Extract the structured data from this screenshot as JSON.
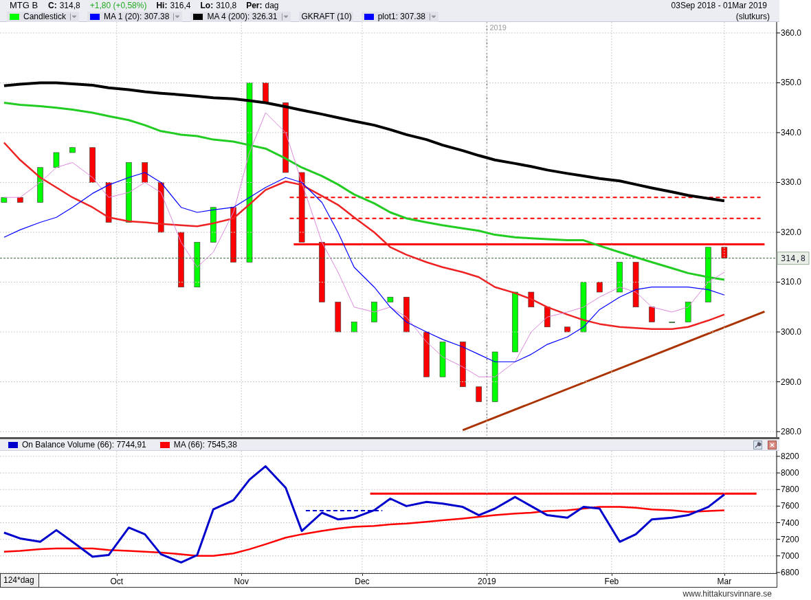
{
  "header": {
    "symbol": "MTG B",
    "fields": [
      {
        "label": "C:",
        "value": "314,8"
      },
      {
        "label": "Hi:",
        "value": "316,4"
      },
      {
        "label": "Lo:",
        "value": "310,8"
      },
      {
        "label": "Per:",
        "value": "dag"
      }
    ],
    "change": "+1,80 (+0,58%)",
    "date_range": "03Sep 2018 - 01Mar 2019",
    "price_type": "(slutkurs)"
  },
  "legend": [
    {
      "label": "Candlestick",
      "color": "#00ff00",
      "dropdown": true
    },
    {
      "label": "MA 1 (20): 307.38",
      "color": "#0000ff",
      "dropdown": true
    },
    {
      "label": "MA 4 (200): 326.31",
      "color": "#000000",
      "dropdown": true
    },
    {
      "label": "GKRAFT (10)",
      "dropdown": false
    },
    {
      "label": "plot1: 307.38",
      "color": "#0000ff",
      "dropdown": true
    }
  ],
  "price_chart": {
    "chart_data": {
      "type": "line",
      "grid": true,
      "ylim": [
        278.9,
        362.2
      ],
      "yticks": [
        {
          "value": 280,
          "label": "280.0"
        },
        {
          "value": 290,
          "label": "290.0"
        },
        {
          "value": 300,
          "label": "300.0"
        },
        {
          "value": 310,
          "label": "310.0"
        },
        {
          "value": 320,
          "label": "320.0"
        },
        {
          "value": 330,
          "label": "330.0"
        },
        {
          "value": 340,
          "label": "340.0"
        },
        {
          "value": 350,
          "label": "350.0"
        },
        {
          "value": 360,
          "label": "360.0"
        }
      ],
      "series": [
        {
          "color": "#000000",
          "values": [
            349.4,
            349.7,
            350,
            350,
            349.8,
            349.5,
            349,
            348.6,
            348.2,
            347.9,
            347.6,
            347.3,
            347,
            346.8,
            346.4,
            346,
            345.2,
            344.5,
            343.7,
            343,
            342.3,
            341.5,
            340.6,
            339.6,
            338.6,
            337.5,
            336.4,
            335.4,
            334.5,
            333.8,
            333.2,
            332.5,
            331.8,
            331.3,
            330.8,
            330.3,
            329.6,
            328.9,
            328.1,
            327.4,
            326.8,
            326.3
          ]
        },
        {
          "color": "#22cc22",
          "values": [
            346,
            345.6,
            345.3,
            345,
            344.6,
            344,
            343.3,
            342.5,
            341.5,
            340.3,
            339.6,
            339.3,
            338.6,
            338.2,
            337.5,
            336.8,
            334.8,
            333,
            331.3,
            329.6,
            327.6,
            325.8,
            324,
            322.8,
            322,
            321.4,
            320.8,
            320.3,
            319.5,
            319,
            318.8,
            318.6,
            318.4,
            318.4,
            317.3,
            316,
            315,
            314,
            312.8,
            311.8,
            311,
            310.5
          ]
        },
        {
          "color": "#ee2222",
          "values": [
            338,
            334.5,
            331,
            329,
            327,
            325,
            323,
            322.2,
            322,
            321.7,
            321.4,
            321.2,
            321.8,
            322.8,
            325.6,
            328.5,
            330.2,
            329.5,
            327.3,
            325.5,
            323,
            320,
            317,
            315.5,
            314,
            313,
            312,
            311,
            309,
            307.8,
            306.6,
            305,
            303.5,
            302.4,
            301.6,
            301,
            300.8,
            300.6,
            300.6,
            301,
            302.3,
            303.5
          ]
        },
        {
          "color": "#dd88dd",
          "values": [
            327,
            327,
            330,
            333,
            334,
            331,
            327,
            328,
            330,
            328,
            318,
            313,
            316,
            324,
            336,
            344,
            340,
            330,
            318,
            312,
            305,
            304,
            305,
            303,
            298,
            295,
            293,
            291,
            291,
            294,
            300,
            303,
            304,
            305,
            307,
            309,
            308,
            305,
            304,
            305,
            310,
            312
          ]
        },
        {
          "color": "#0000ff",
          "values": [
            319,
            320.5,
            322,
            323,
            325,
            327.8,
            329.5,
            331,
            332,
            330,
            325,
            324,
            324.5,
            325,
            327,
            329,
            331,
            330,
            326,
            320,
            313,
            309,
            305,
            302,
            300,
            298.5,
            297,
            295.5,
            294,
            294,
            295.5,
            297.5,
            299,
            301,
            304.5,
            307,
            308.5,
            309,
            309,
            309,
            308.5,
            307.4
          ]
        }
      ],
      "annotations": [
        "2019",
        "314,8"
      ]
    }
  },
  "obv_panel": {
    "legend": [
      {
        "label": "On Balance Volume (66): 7744,91",
        "color": "#0000cc"
      },
      {
        "label": "MA (66): 7545,38",
        "color": "#ff0000"
      }
    ],
    "chart_data": {
      "type": "line",
      "grid": true,
      "x": [
        "2018-09-03",
        "2018-09-07",
        "2018-09-12",
        "2018-09-16",
        "2018-09-20",
        "2018-09-25",
        "2018-09-29",
        "2018-10-04",
        "2018-10-08",
        "2018-10-12",
        "2018-10-17",
        "2018-10-21",
        "2018-10-25",
        "2018-10-30",
        "2018-11-03",
        "2018-11-07",
        "2018-11-12",
        "2018-11-16",
        "2018-11-21",
        "2018-11-25",
        "2018-11-29",
        "2018-12-04",
        "2018-12-08",
        "2018-12-12",
        "2018-12-17",
        "2018-12-21",
        "2018-12-26",
        "2018-12-30",
        "2019-01-03",
        "2019-01-08",
        "2019-01-12",
        "2019-01-16",
        "2019-01-21",
        "2019-01-25",
        "2019-01-29",
        "2019-02-03",
        "2019-02-07",
        "2019-02-11",
        "2019-02-16",
        "2019-02-20",
        "2019-02-25",
        "2019-03-01"
      ],
      "xlim": [
        "2018-09-02",
        "2019-03-14"
      ],
      "ylim": [
        6791,
        8266
      ],
      "xticks": [
        {
          "value": "2018-10-01",
          "label": "Oct"
        },
        {
          "value": "2018-11-01",
          "label": "Nov"
        },
        {
          "value": "2018-12-01",
          "label": "Dec"
        },
        {
          "value": "2019-01-01",
          "label": "2019"
        },
        {
          "value": "2019-02-01",
          "label": "Feb"
        },
        {
          "value": "2019-03-01",
          "label": "Mar"
        }
      ],
      "yticks": [
        {
          "value": 6800,
          "label": "6800"
        },
        {
          "value": 7000,
          "label": "7000"
        },
        {
          "value": 7200,
          "label": "7200"
        },
        {
          "value": 7400,
          "label": "7400"
        },
        {
          "value": 7600,
          "label": "7600"
        },
        {
          "value": 7800,
          "label": "7800"
        },
        {
          "value": 8000,
          "label": "8000"
        },
        {
          "value": 8200,
          "label": "8200"
        }
      ],
      "series": [
        {
          "color": "#ff0000",
          "values": [
            7050,
            7060,
            7080,
            7090,
            7090,
            7090,
            7070,
            7060,
            7050,
            7040,
            7020,
            7000,
            7000,
            7030,
            7080,
            7140,
            7220,
            7260,
            7300,
            7330,
            7350,
            7360,
            7380,
            7390,
            7410,
            7430,
            7450,
            7470,
            7490,
            7510,
            7520,
            7540,
            7550,
            7570,
            7590,
            7590,
            7580,
            7560,
            7550,
            7530,
            7540,
            7550
          ]
        },
        {
          "color": "#0000cc",
          "values": [
            7280,
            7210,
            7170,
            7310,
            7170,
            6990,
            7010,
            7340,
            7260,
            7020,
            6920,
            7010,
            7560,
            7670,
            7920,
            8080,
            7820,
            7300,
            7520,
            7440,
            7460,
            7550,
            7690,
            7600,
            7650,
            7630,
            7590,
            7490,
            7570,
            7710,
            7600,
            7490,
            7460,
            7590,
            7570,
            7170,
            7260,
            7440,
            7460,
            7490,
            7590,
            7740
          ]
        }
      ]
    }
  },
  "x_axis": {
    "period": "124*dag"
  },
  "footer": {
    "url": "www.hittakursvinnare.se"
  }
}
